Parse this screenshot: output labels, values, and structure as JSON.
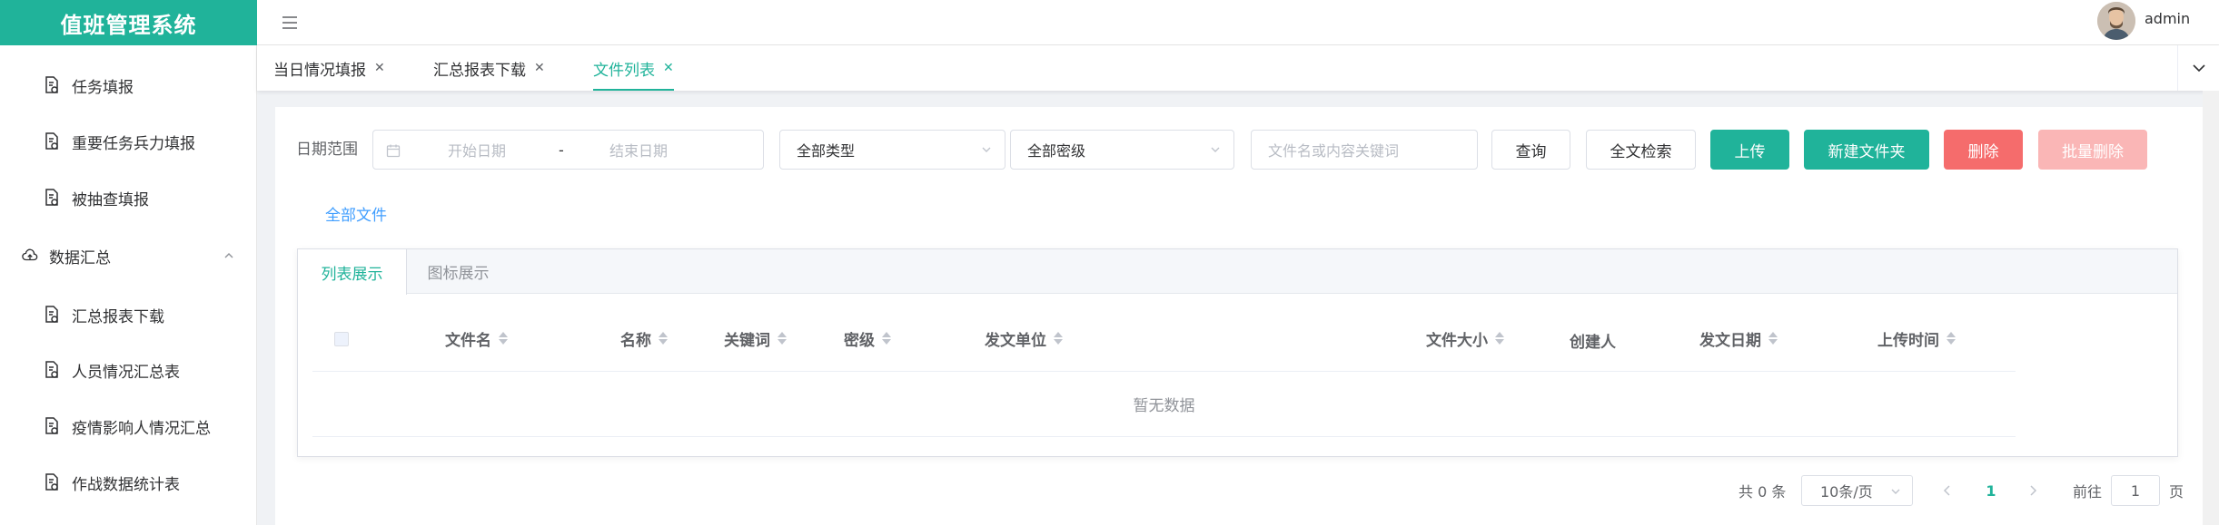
{
  "app": {
    "title": "值班管理系统",
    "user": "admin"
  },
  "colors": {
    "brand": "#20b39a",
    "link": "#409eff",
    "danger": "#f56c6c",
    "danger_disabled": "#fab6b6"
  },
  "sidebar": {
    "items": [
      {
        "label": "任务填报",
        "icon": "document-settings-icon"
      },
      {
        "label": "重要任务兵力填报",
        "icon": "document-settings-icon"
      },
      {
        "label": "被抽查填报",
        "icon": "document-settings-icon"
      }
    ],
    "group": {
      "label": "数据汇总",
      "icon": "cloud-upload-icon",
      "expanded": true
    },
    "group_items": [
      {
        "label": "汇总报表下载",
        "icon": "document-settings-icon"
      },
      {
        "label": "人员情况汇总表",
        "icon": "document-settings-icon"
      },
      {
        "label": "疫情影响人情况汇总",
        "icon": "document-settings-icon"
      },
      {
        "label": "作战数据统计表",
        "icon": "document-settings-icon"
      }
    ]
  },
  "tabs": [
    {
      "label": "当日情况填报",
      "active": false
    },
    {
      "label": "汇总报表下载",
      "active": false
    },
    {
      "label": "文件列表",
      "active": true
    }
  ],
  "filters": {
    "date_label": "日期范围",
    "start_placeholder": "开始日期",
    "separator": "-",
    "end_placeholder": "结束日期",
    "type_value": "全部类型",
    "secret_value": "全部密级",
    "keyword_placeholder": "文件名或内容关键词"
  },
  "buttons": {
    "query": "查询",
    "fulltext": "全文检索",
    "upload": "上传",
    "new_folder": "新建文件夹",
    "delete": "删除",
    "batch_delete": "批量删除"
  },
  "breadcrumb": {
    "all_files": "全部文件"
  },
  "view_tabs": {
    "list": "列表展示",
    "icon": "图标展示"
  },
  "table": {
    "columns": [
      {
        "label": "文件名",
        "sortable": true
      },
      {
        "label": "名称",
        "sortable": true
      },
      {
        "label": "关键词",
        "sortable": true
      },
      {
        "label": "密级",
        "sortable": true
      },
      {
        "label": "发文单位",
        "sortable": true
      },
      {
        "label": "文件大小",
        "sortable": true
      },
      {
        "label": "创建人",
        "sortable": false
      },
      {
        "label": "发文日期",
        "sortable": true
      },
      {
        "label": "上传时间",
        "sortable": true
      }
    ],
    "empty_text": "暂无数据"
  },
  "pagination": {
    "total": "共 0 条",
    "page_size": "10条/页",
    "current_page": "1",
    "goto_label": "前往",
    "goto_value": "1",
    "page_suffix": "页"
  }
}
